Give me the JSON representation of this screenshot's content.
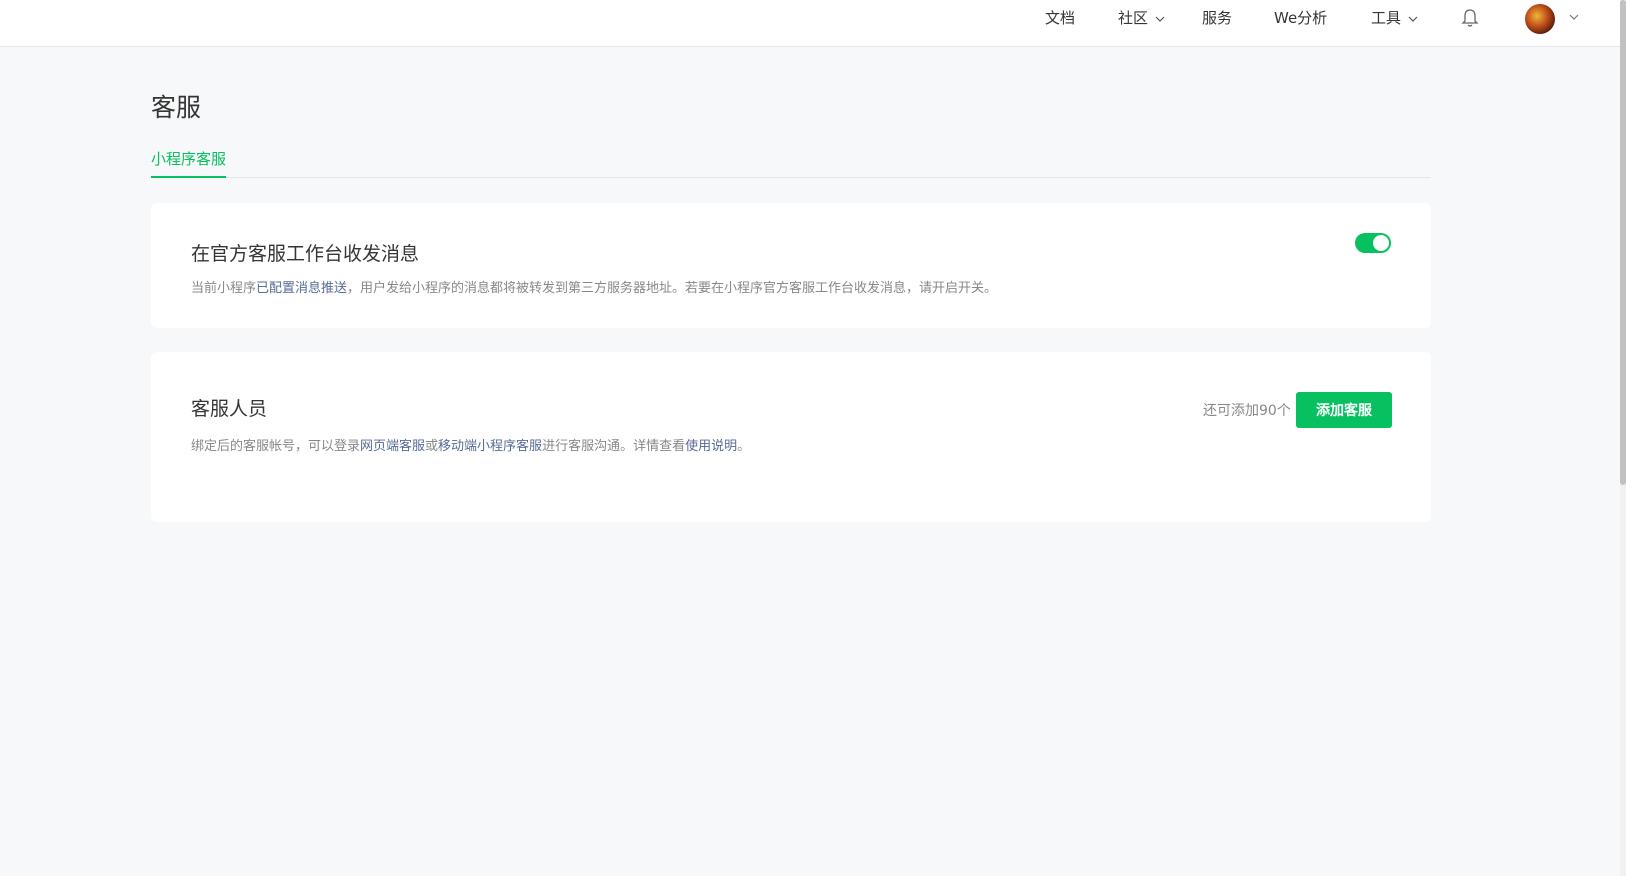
{
  "topnav": {
    "items": [
      {
        "label": "文档",
        "has_dropdown": false
      },
      {
        "label": "社区",
        "has_dropdown": true
      },
      {
        "label": "服务",
        "has_dropdown": false
      },
      {
        "label": "We分析",
        "has_dropdown": false
      },
      {
        "label": "工具",
        "has_dropdown": true
      }
    ],
    "icons": {
      "notifications": "bell-icon",
      "user": "avatar",
      "user_menu": "chevron-down-icon"
    }
  },
  "page": {
    "title": "客服",
    "tabs": [
      {
        "label": "小程序客服",
        "active": true
      }
    ]
  },
  "official_workbench": {
    "title": "在官方客服工作台收发消息",
    "desc_prefix": "当前小程序",
    "desc_link": "已配置消息推送",
    "desc_suffix": "，用户发给小程序的消息都将被转发到第三方服务器地址。若要在小程序官方客服工作台收发消息，请开启开关。",
    "toggle_on": true
  },
  "staff": {
    "title": "客服人员",
    "remaining": "还可添加90个",
    "add_button": "添加客服",
    "desc_part1": "绑定后的客服帐号，可以登录",
    "link_web": "网页端客服",
    "desc_or": "或",
    "link_mobile": "移动端小程序客服",
    "desc_part2": "进行客服沟通。详情查看",
    "link_help": "使用说明",
    "desc_end": "。"
  },
  "colors": {
    "accent": "#07c160",
    "link": "#576b95",
    "background": "#f7f8fa",
    "card": "#ffffff"
  }
}
